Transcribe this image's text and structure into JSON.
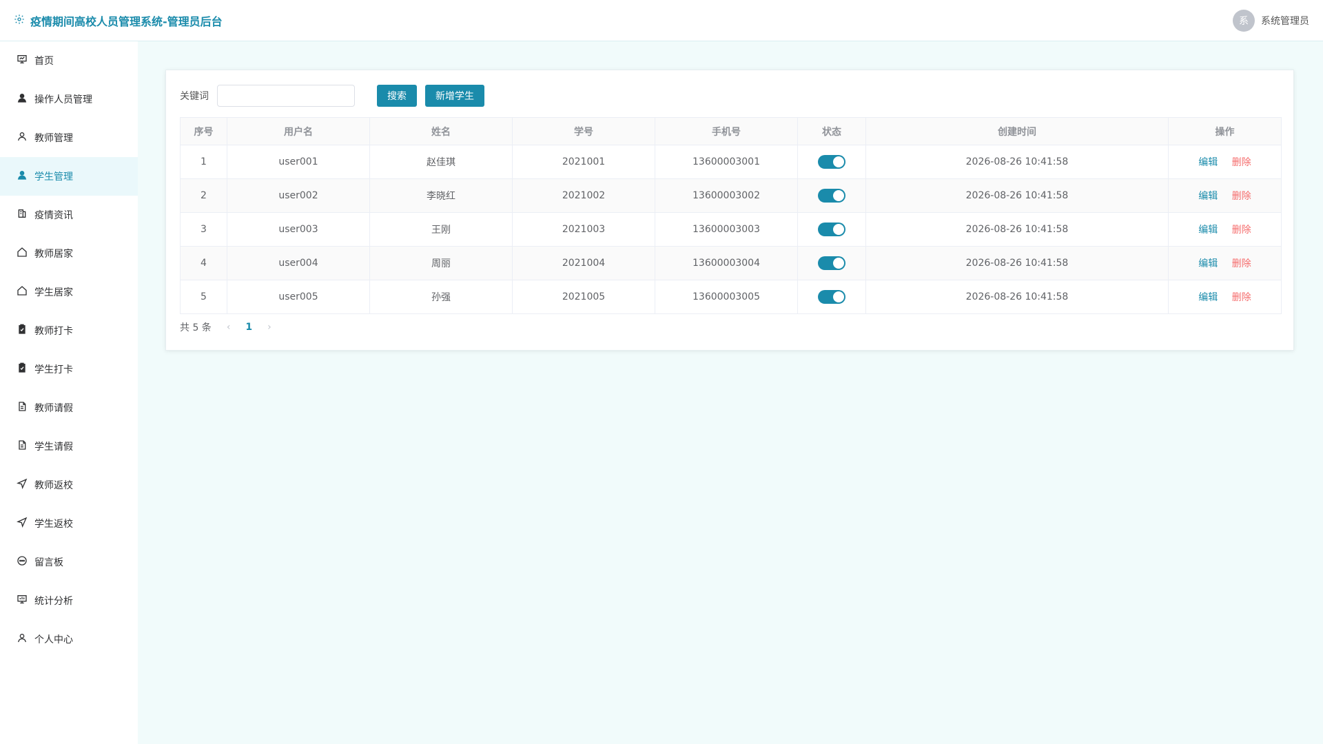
{
  "app": {
    "title": "疫情期间高校人员管理系统-管理员后台",
    "brand_color": "#1a8bab"
  },
  "user": {
    "avatar_text": "系",
    "name": "系统管理员"
  },
  "sidebar": {
    "items": [
      {
        "label": "首页",
        "icon": "dashboard-icon"
      },
      {
        "label": "操作人员管理",
        "icon": "user-icon"
      },
      {
        "label": "教师管理",
        "icon": "user-outline-icon"
      },
      {
        "label": "学生管理",
        "icon": "user-icon",
        "active": true
      },
      {
        "label": "疫情资讯",
        "icon": "news-icon"
      },
      {
        "label": "教师居家",
        "icon": "home-icon"
      },
      {
        "label": "学生居家",
        "icon": "home-icon"
      },
      {
        "label": "教师打卡",
        "icon": "checkin-icon"
      },
      {
        "label": "学生打卡",
        "icon": "checkin-icon"
      },
      {
        "label": "教师请假",
        "icon": "document-icon"
      },
      {
        "label": "学生请假",
        "icon": "document-icon"
      },
      {
        "label": "教师返校",
        "icon": "send-icon"
      },
      {
        "label": "学生返校",
        "icon": "send-icon"
      },
      {
        "label": "留言板",
        "icon": "chat-icon"
      },
      {
        "label": "统计分析",
        "icon": "chart-icon"
      },
      {
        "label": "个人中心",
        "icon": "profile-icon"
      }
    ]
  },
  "toolbar": {
    "keyword_label": "关键词",
    "keyword_value": "",
    "search_label": "搜索",
    "add_label": "新增学生"
  },
  "table": {
    "columns": [
      "序号",
      "用户名",
      "姓名",
      "学号",
      "手机号",
      "状态",
      "创建时间",
      "操作"
    ],
    "rows": [
      {
        "index": "1",
        "username": "user001",
        "name": "赵佳琪",
        "student_no": "2021001",
        "phone": "13600003001",
        "status": true,
        "created_at": "2026-08-26 10:41:58"
      },
      {
        "index": "2",
        "username": "user002",
        "name": "李晓红",
        "student_no": "2021002",
        "phone": "13600003002",
        "status": true,
        "created_at": "2026-08-26 10:41:58"
      },
      {
        "index": "3",
        "username": "user003",
        "name": "王刚",
        "student_no": "2021003",
        "phone": "13600003003",
        "status": true,
        "created_at": "2026-08-26 10:41:58"
      },
      {
        "index": "4",
        "username": "user004",
        "name": "周丽",
        "student_no": "2021004",
        "phone": "13600003004",
        "status": true,
        "created_at": "2026-08-26 10:41:58"
      },
      {
        "index": "5",
        "username": "user005",
        "name": "孙强",
        "student_no": "2021005",
        "phone": "13600003005",
        "status": true,
        "created_at": "2026-08-26 10:41:58"
      }
    ],
    "actions": {
      "edit": "编辑",
      "delete": "删除"
    }
  },
  "pagination": {
    "total_text": "共 5 条",
    "current_page": "1",
    "prev": "‹",
    "next": "›"
  }
}
